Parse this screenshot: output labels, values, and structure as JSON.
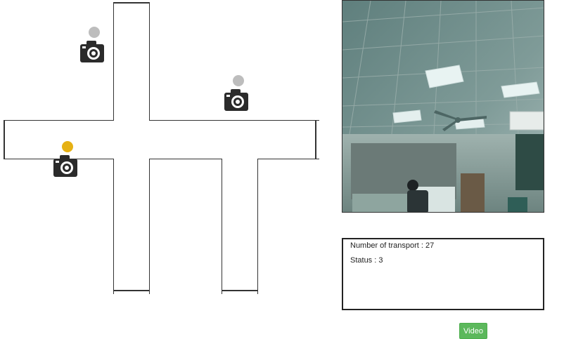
{
  "map": {
    "cameras": [
      {
        "id": "camera-1",
        "status_color": "#bdbdbd"
      },
      {
        "id": "camera-2",
        "status_color": "#bdbdbd"
      },
      {
        "id": "camera-3",
        "status_color": "#e6b114"
      }
    ]
  },
  "info": {
    "transport_label": "Number of transport : ",
    "transport_value": "27",
    "status_label": "Status : ",
    "status_value": "3"
  },
  "buttons": {
    "video_label": "Video"
  },
  "colors": {
    "camera_icon": "#2b2b2b",
    "button_bg": "#5cb85c"
  }
}
